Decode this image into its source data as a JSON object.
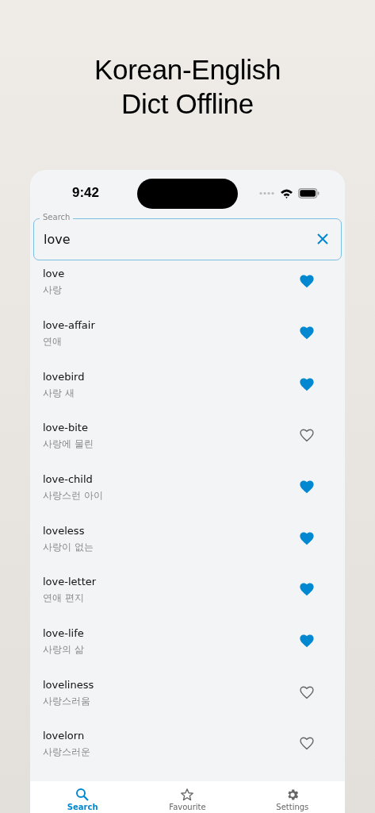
{
  "headline": "Korean-English\nDict Offline",
  "status_bar": {
    "time": "9:42"
  },
  "search": {
    "label": "Search",
    "value": "love"
  },
  "results": [
    {
      "word": "love",
      "translation": "사랑",
      "favourite": true
    },
    {
      "word": "love-affair",
      "translation": "연애",
      "favourite": true
    },
    {
      "word": "lovebird",
      "translation": "사랑 새",
      "favourite": true
    },
    {
      "word": "love-bite",
      "translation": "사랑에 물린",
      "favourite": false
    },
    {
      "word": "love-child",
      "translation": "사랑스런 아이",
      "favourite": true
    },
    {
      "word": "loveless",
      "translation": "사랑이 없는",
      "favourite": true
    },
    {
      "word": "love-letter",
      "translation": "연애 편지",
      "favourite": true
    },
    {
      "word": "love-life",
      "translation": "사랑의 삶",
      "favourite": true
    },
    {
      "word": "loveliness",
      "translation": "사랑스러움",
      "favourite": false
    },
    {
      "word": "lovelorn",
      "translation": "사랑스러운",
      "favourite": false
    }
  ],
  "tabs": [
    {
      "kind": "search",
      "label": "Search",
      "selected": true
    },
    {
      "kind": "favourite",
      "label": "Favourite",
      "selected": false
    },
    {
      "kind": "settings",
      "label": "Settings",
      "selected": false
    }
  ]
}
